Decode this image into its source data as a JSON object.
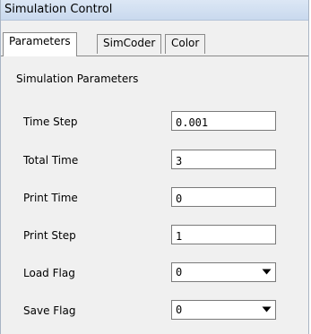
{
  "window": {
    "title": "Simulation Control"
  },
  "tabs": [
    {
      "label": "Parameters",
      "active": true
    },
    {
      "label": "SimCoder",
      "active": false
    },
    {
      "label": "Color",
      "active": false
    }
  ],
  "section": {
    "title": "Simulation Parameters"
  },
  "fields": {
    "time_step": {
      "label": "Time Step",
      "value": "0.001"
    },
    "total_time": {
      "label": "Total Time",
      "value": "3"
    },
    "print_time": {
      "label": "Print Time",
      "value": "0"
    },
    "print_step": {
      "label": "Print Step",
      "value": "1"
    },
    "load_flag": {
      "label": "Load Flag",
      "value": "0"
    },
    "save_flag": {
      "label": "Save Flag",
      "value": "0"
    }
  },
  "icons": {
    "dropdown": "chevron-down-icon"
  }
}
